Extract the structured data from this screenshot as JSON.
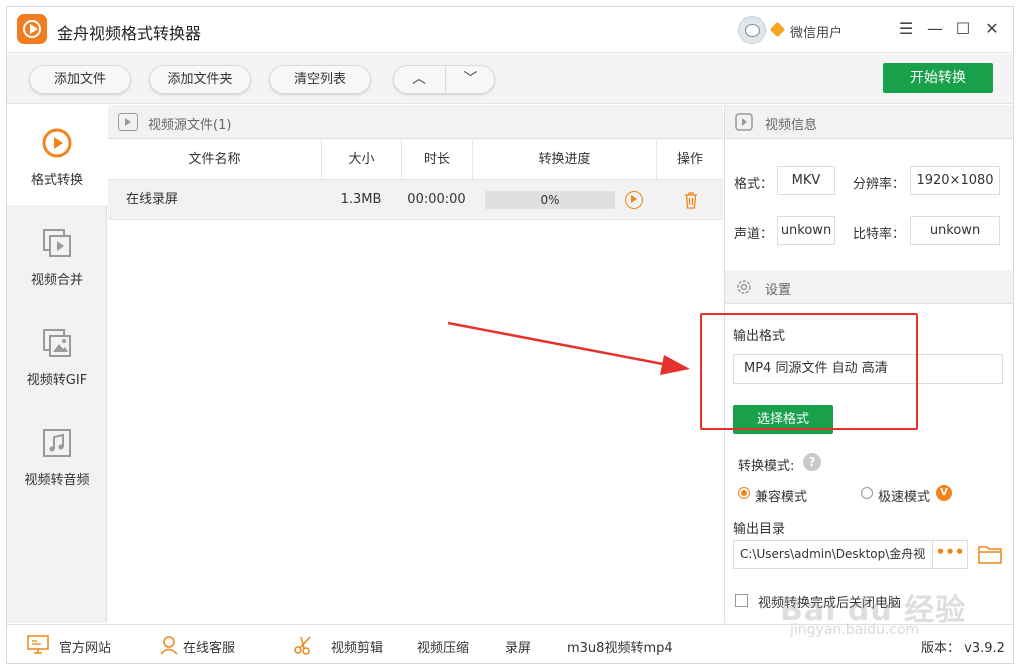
{
  "app": {
    "title": "金舟视频格式转换器",
    "username": "微信用户"
  },
  "window_controls": {
    "menu": "☰",
    "minimize": "—",
    "maximize": "☐",
    "close": "✕"
  },
  "toolbar": {
    "add_file": "添加文件",
    "add_folder": "添加文件夹",
    "clear_list": "清空列表",
    "move_up": "︿",
    "move_down": "﹀",
    "start": "开始转换"
  },
  "sidebar": {
    "items": [
      {
        "label": "格式转换",
        "icon": "format-convert-icon",
        "active": true
      },
      {
        "label": "视频合并",
        "icon": "video-merge-icon",
        "active": false
      },
      {
        "label": "视频转GIF",
        "icon": "gif-icon",
        "active": false
      },
      {
        "label": "视频转音频",
        "icon": "music-icon",
        "active": false
      }
    ]
  },
  "file_panel": {
    "header": "视频源文件(1)",
    "columns": [
      "文件名称",
      "大小",
      "时长",
      "转换进度",
      "操作"
    ],
    "rows": [
      {
        "name": "在线录屏",
        "size": "1.3MB",
        "duration": "00:00:00",
        "progress": "0%",
        "progress_value": 0
      }
    ]
  },
  "video_info": {
    "header": "视频信息",
    "format_label": "格式：",
    "format_value": "MKV",
    "resolution_label": "分辨率：",
    "resolution_value": "1920×1080",
    "channel_label": "声道：",
    "channel_value": "unkown",
    "bitrate_label": "比特率：",
    "bitrate_value": "unkown"
  },
  "settings": {
    "header": "设置",
    "output_format_label": "输出格式",
    "output_format_value": "MP4 同源文件 自动 高清",
    "select_format_button": "选择格式",
    "mode_label": "转换模式:",
    "help_glyph": "?",
    "mode_compat": "兼容模式",
    "mode_fast": "极速模式",
    "vip_badge": "V",
    "output_dir_label": "输出目录",
    "output_dir_value": "C:\\Users\\admin\\Desktop\\金舟视",
    "more_glyph": "•••",
    "shutdown_label": "视频转换完成后关闭电脑"
  },
  "footer": {
    "website": "官方网站",
    "support": "在线客服",
    "edit": "视频剪辑",
    "compress": "视频压缩",
    "record": "录屏",
    "m3u8": "m3u8视频转mp4",
    "version": "版本： v3.9.2"
  },
  "watermark": {
    "text": "Bai du 经验",
    "url": "jingyan.baidu.com"
  },
  "colors": {
    "accent": "#f08519",
    "primary_green": "#19a04b",
    "annotation_red": "#e5322d"
  }
}
